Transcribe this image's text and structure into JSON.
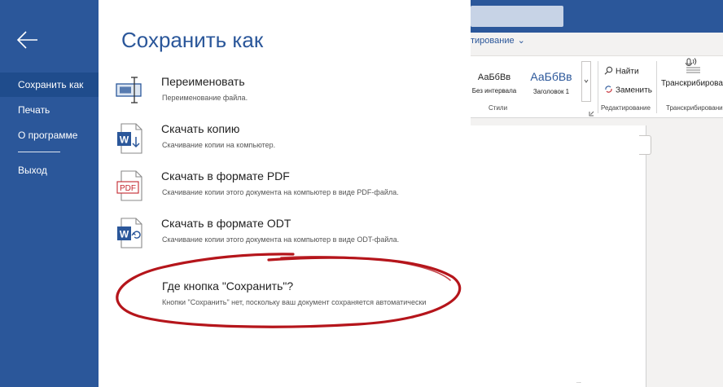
{
  "rail": {
    "back_icon": "arrow-left-icon",
    "items": [
      {
        "label": "Сохранить как",
        "active": true
      },
      {
        "label": "Печать",
        "active": false
      },
      {
        "label": "О программе",
        "active": false
      },
      {
        "label": "Выход",
        "active": false
      }
    ]
  },
  "panel": {
    "title": "Сохранить как",
    "options": [
      {
        "icon": "rename-icon",
        "title": "Переименовать",
        "desc": "Переименование файла."
      },
      {
        "icon": "word-download-icon",
        "title": "Скачать копию",
        "desc": "Скачивание копии на компьютер."
      },
      {
        "icon": "pdf-icon",
        "icon_text": "PDF",
        "title": "Скачать в формате PDF",
        "desc": "Скачивание копии этого документа на компьютер в виде PDF-файла."
      },
      {
        "icon": "word-odt-icon",
        "title": "Скачать в формате ODT",
        "desc": "Скачивание копии этого документа на компьютер в виде ODT-файла."
      }
    ],
    "faq": {
      "title": "Где кнопка \"Сохранить\"?",
      "desc": "Кнопки \"Сохранить\" нет, поскольку ваш документ сохраняется автоматически"
    },
    "annotation_color": "#b5151b"
  },
  "word": {
    "tab_partial": "тирование",
    "styles": [
      {
        "preview": "АаБбВв",
        "name": "Без интервала"
      },
      {
        "preview": "АаБбВв",
        "name": "Заголовок 1"
      }
    ],
    "groups": {
      "styles_label": "Стили",
      "editing_label": "Редактирование",
      "transcribe_label": "Транскрибирование"
    },
    "buttons": {
      "find": "Найти",
      "replace": "Заменить",
      "transcribe": "Транскрибировать"
    },
    "status_fragment": "..."
  },
  "colors": {
    "rail_bg": "#2b579a",
    "rail_active": "#1f4c8c",
    "accent": "#2b579a",
    "word_blue": "#2b579a",
    "pdf_red": "#c4262e"
  }
}
